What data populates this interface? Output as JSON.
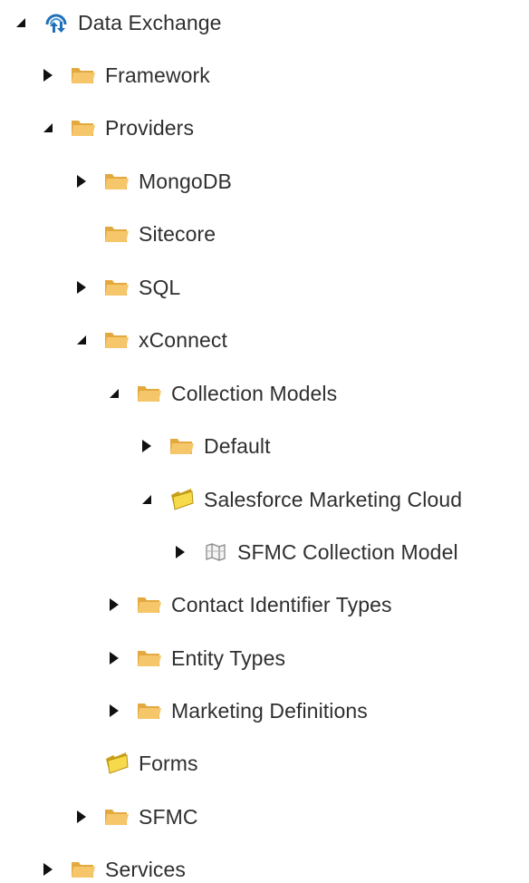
{
  "tree": {
    "data_exchange": {
      "label": "Data Exchange",
      "icon": "data-exchange-icon",
      "state": "expanded"
    },
    "framework": {
      "label": "Framework",
      "icon": "folder-icon",
      "state": "collapsed"
    },
    "providers": {
      "label": "Providers",
      "icon": "folder-icon",
      "state": "expanded"
    },
    "mongodb": {
      "label": "MongoDB",
      "icon": "folder-icon",
      "state": "collapsed"
    },
    "sitecore": {
      "label": "Sitecore",
      "icon": "folder-icon",
      "state": "leaf"
    },
    "sql": {
      "label": "SQL",
      "icon": "folder-icon",
      "state": "collapsed"
    },
    "xconnect": {
      "label": "xConnect",
      "icon": "folder-icon",
      "state": "expanded"
    },
    "collection_models": {
      "label": "Collection Models",
      "icon": "folder-icon",
      "state": "expanded"
    },
    "default": {
      "label": "Default",
      "icon": "folder-icon",
      "state": "collapsed"
    },
    "sfmc_folder": {
      "label": "Salesforce Marketing Cloud",
      "icon": "yellow-folder-icon",
      "state": "expanded"
    },
    "sfmc_collection_model": {
      "label": "SFMC Collection Model",
      "icon": "map-icon",
      "state": "collapsed"
    },
    "contact_identifier_types": {
      "label": "Contact Identifier Types",
      "icon": "folder-icon",
      "state": "collapsed"
    },
    "entity_types": {
      "label": "Entity Types",
      "icon": "folder-icon",
      "state": "collapsed"
    },
    "marketing_definitions": {
      "label": "Marketing Definitions",
      "icon": "folder-icon",
      "state": "collapsed"
    },
    "forms": {
      "label": "Forms",
      "icon": "yellow-folder-icon",
      "state": "leaf"
    },
    "sfmc": {
      "label": "SFMC",
      "icon": "folder-icon",
      "state": "collapsed"
    },
    "services": {
      "label": "Services",
      "icon": "folder-icon",
      "state": "collapsed"
    }
  },
  "colors": {
    "folder": "#f5c76a",
    "folder_dark": "#e3a93f",
    "yellow_folder": "#f7d94c",
    "arrow": "#111111",
    "text": "#2f2f2f",
    "data_exchange_blue": "#1f6fb8"
  }
}
